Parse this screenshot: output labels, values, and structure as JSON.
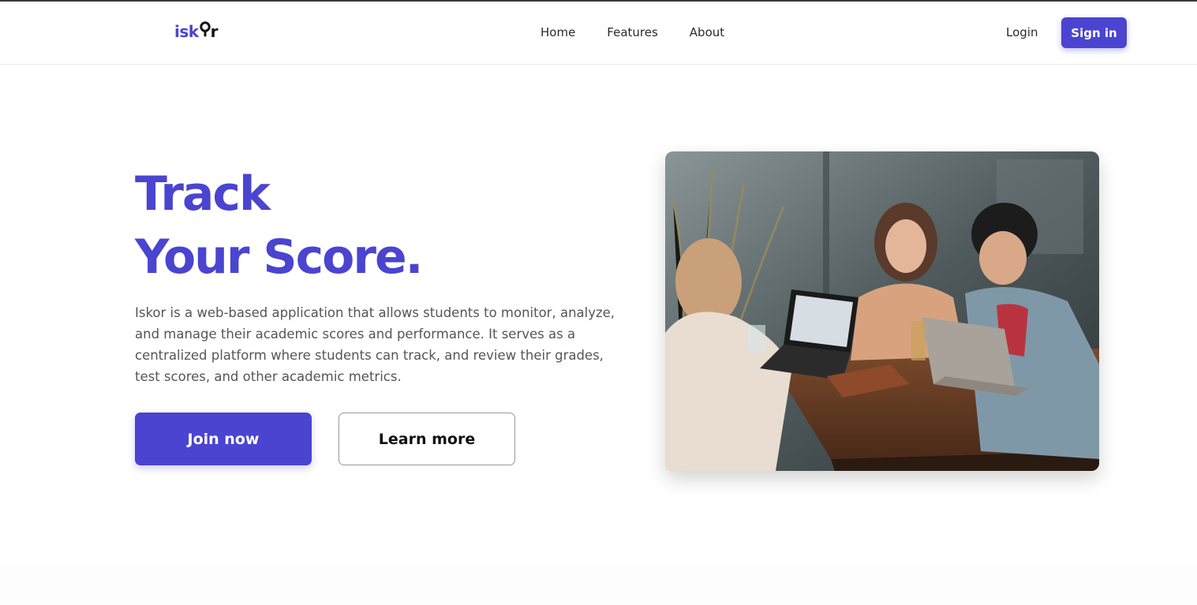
{
  "brand": {
    "logo_left": "isk",
    "logo_right": "r",
    "accent_color": "#4a44d0"
  },
  "nav": {
    "items": [
      {
        "label": "Home"
      },
      {
        "label": "Features"
      },
      {
        "label": "About"
      }
    ],
    "login_label": "Login",
    "signin_label": "Sign in"
  },
  "hero": {
    "title_line1": "Track",
    "title_line2": "Your Score.",
    "description": "Iskor is a web-based application that allows students to monitor, analyze, and manage their academic scores and performance. It serves as a centralized platform where students can track, and review their grades, test scores, and other academic metrics.",
    "join_label": "Join now",
    "learn_label": "Learn more",
    "image_icon": "hero-photo"
  }
}
